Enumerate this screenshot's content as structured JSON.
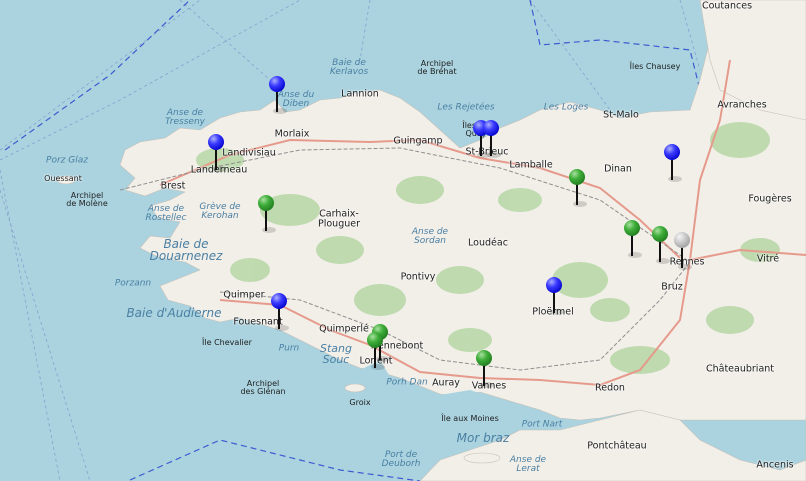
{
  "map": {
    "colors": {
      "sea": "#aad3df",
      "land": "#f1eee8",
      "forest": "#add19e",
      "motorway": "#e8a0a0",
      "boundary": "#5a6fc9",
      "rail": "#999999"
    },
    "labels": {
      "coutances": "Coutances",
      "iles_chausey": "Îles Chausey",
      "avranches": "Avranches",
      "st_malo": "St-Malo",
      "dinan": "Dinan",
      "fougeres": "Fougères",
      "rennes": "Rennes",
      "vitre": "Vitré",
      "bruz": "Bruz",
      "chateaubriant": "Châteaubriant",
      "redon": "Redon",
      "pontchateau": "Pontchâteau",
      "ancenis": "Ancenis",
      "vannes": "Vannes",
      "auray": "Auray",
      "ploermel": "Ploërmel",
      "loudeac": "Loudéac",
      "pontivy": "Pontivy",
      "lamballe": "Lamballe",
      "st_brieuc": "St-Brieuc",
      "guingamp": "Guingamp",
      "lannion": "Lannion",
      "morlaix": "Morlaix",
      "landivisiau": "Landivisiau",
      "landerneau": "Landerneau",
      "brest": "Brest",
      "ouessant": "Ouessant",
      "molene": "Archipel\nde Molène",
      "carhaix": "Carhaix-\nPlouguer",
      "quimper": "Quimper",
      "fouesnant": "Fouesnant",
      "quimperle": "Quimperlé",
      "hennebont": "Hennebont",
      "lorient": "Lorient",
      "groix": "Groix",
      "ile_chevalier": "Île Chevalier",
      "glenan": "Archipel\ndes Glénan",
      "ile_aux_moines": "Île aux Moines",
      "anse_tresseny": "Anse de\nTresseny",
      "porz_glaz": "Porz Glaz",
      "baie_kerlavos": "Baie de\nKerlavos",
      "archipel_brehat": "Archipel\nde Bréhat",
      "anse_diben": "Anse du\nDiben",
      "les_rejetees": "Les Rejetées",
      "iles_st_quay": "Îles St-\nQuay",
      "les_loges": "Les Loges",
      "anse_rostellec": "Anse de\nRostellec",
      "greve_kerohan": "Grève de\nKerohan",
      "baie_douarnenez": "Baie de\nDouarnenez",
      "anse_sordan": "Anse de\nSordan",
      "porzann": "Porzann",
      "baie_audierne": "Baie d'Audierne",
      "purn": "Purn",
      "stang_souc": "Stang\nSouc",
      "porh_dan": "Porh Dan",
      "port_nart": "Port Nart",
      "mor_braz": "Mor braz",
      "port_deuborh": "Port de\nDeuborh",
      "anse_lerat": "Anse de\nLerat"
    },
    "markers": [
      {
        "color": "blue"
      },
      {
        "color": "blue"
      },
      {
        "color": "blue"
      },
      {
        "color": "blue"
      },
      {
        "color": "blue"
      },
      {
        "color": "blue"
      },
      {
        "color": "blue"
      },
      {
        "color": "blue"
      },
      {
        "color": "green"
      },
      {
        "color": "green"
      },
      {
        "color": "green"
      },
      {
        "color": "green"
      },
      {
        "color": "green"
      },
      {
        "color": "green"
      },
      {
        "color": "green"
      },
      {
        "color": "grey"
      }
    ]
  }
}
